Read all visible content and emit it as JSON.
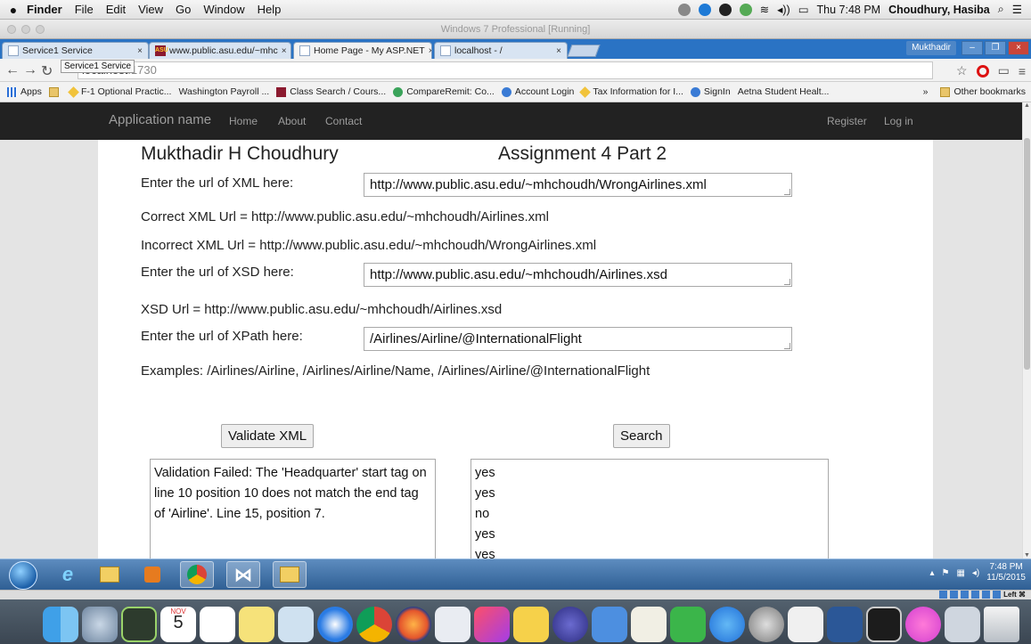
{
  "mac_menubar": {
    "apple": "",
    "items": [
      "Finder",
      "File",
      "Edit",
      "View",
      "Go",
      "Window",
      "Help"
    ],
    "clock": "Thu 7:48 PM",
    "user": "Choudhury, Hasiba"
  },
  "vm": {
    "title": "Windows 7 Professional [Running]"
  },
  "browser": {
    "tabs": [
      {
        "label": "Service1 Service"
      },
      {
        "label": "www.public.asu.edu/~mhc"
      },
      {
        "label": "Home Page - My ASP.NET"
      },
      {
        "label": "localhost - /"
      }
    ],
    "user_badge": "Mukthadir",
    "url_host": "localhost",
    "url_port": ":1730",
    "tooltip": "Service1 Service",
    "bookmarks": [
      "Apps",
      "F-1 Optional Practic...",
      "Washington Payroll ...",
      "Class Search / Cours...",
      "CompareRemit: Co...",
      "Account Login",
      "Tax Information for I...",
      "SignIn",
      "Aetna Student Healt..."
    ],
    "other_bookmarks": "Other bookmarks",
    "chevron": "»"
  },
  "navbar": {
    "brand": "Application name",
    "links": [
      "Home",
      "About",
      "Contact"
    ],
    "register": "Register",
    "login": "Log in"
  },
  "form": {
    "name": "Mukthadir H Choudhury",
    "assignment": "Assignment 4 Part 2",
    "xml_label": "Enter the url of XML here:",
    "xml_value": "http://www.public.asu.edu/~mhchoudh/WrongAirlines.xml",
    "correct_xml": "Correct XML Url = http://www.public.asu.edu/~mhchoudh/Airlines.xml",
    "incorrect_xml": "Incorrect XML Url = http://www.public.asu.edu/~mhchoudh/WrongAirlines.xml",
    "xsd_label": "Enter the url of XSD here:",
    "xsd_value": "http://www.public.asu.edu/~mhchoudh/Airlines.xsd",
    "xsd_url": "XSD Url = http://www.public.asu.edu/~mhchoudh/Airlines.xsd",
    "xpath_label": "Enter the url of XPath here:",
    "xpath_value": "/Airlines/Airline/@InternationalFlight",
    "examples": "Examples: /Airlines/Airline, /Airlines/Airline/Name, /Airlines/Airline/@InternationalFlight",
    "validate_label": "Validate XML",
    "search_label": "Search",
    "validation_message": "Validation Failed: The 'Headquarter' start tag on line 10 position 10 does not match the end tag of 'Airline'. Line 15, position 7.",
    "results": [
      "yes",
      "yes",
      "no",
      "yes",
      "yes"
    ]
  },
  "taskbar": {
    "time": "7:48 PM",
    "date": "11/5/2015"
  },
  "vm_status": {
    "host_key": "Left ⌘"
  },
  "dock": {
    "calendar_month": "NOV",
    "calendar_day": "5"
  }
}
